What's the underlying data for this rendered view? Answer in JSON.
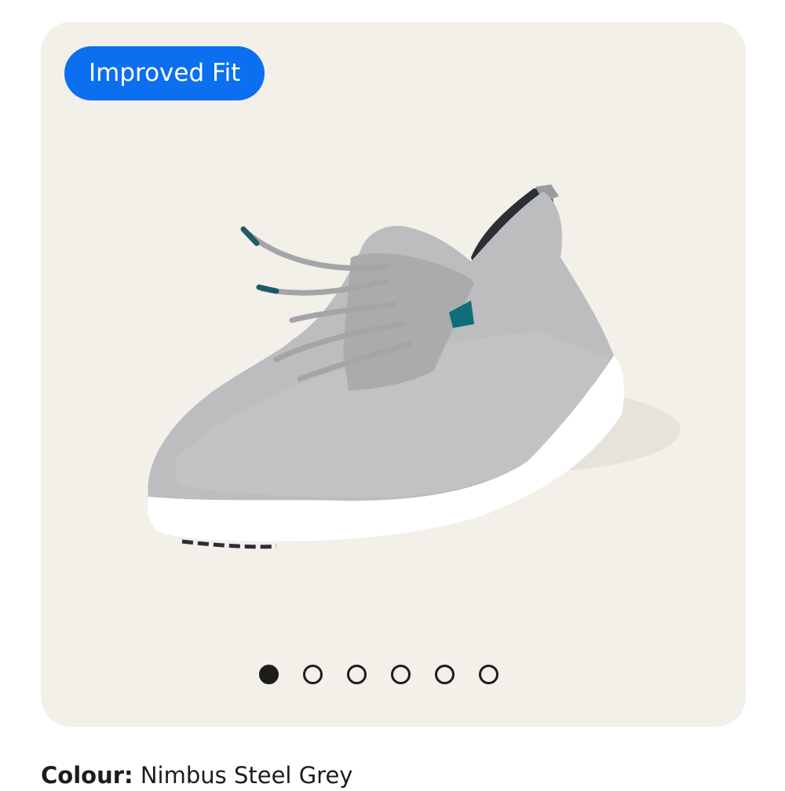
{
  "gallery": {
    "badge": "Improved Fit",
    "image_alt": "Grey knit sneaker with white sole",
    "dot_count": 6,
    "active_index": 0
  },
  "colour": {
    "label": "Colour:",
    "value": "Nimbus Steel Grey"
  },
  "colors": {
    "card_bg": "#f3efe9",
    "badge_bg": "#0b6ff0",
    "accent_teal": "#0f6e78",
    "text": "#1c1c1c"
  }
}
